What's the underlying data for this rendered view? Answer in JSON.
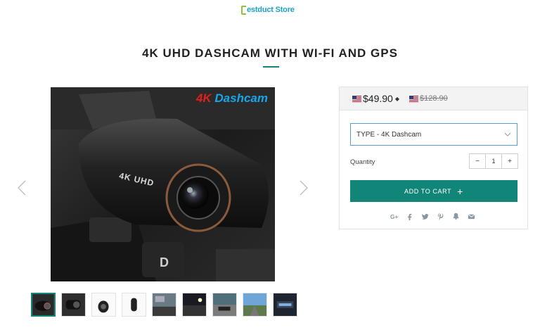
{
  "header": {
    "logo_initial": "B",
    "logo_text": "estduct Store"
  },
  "product": {
    "title": "4K UHD DASHCAM WITH WI-FI AND GPS",
    "image_badge_4k": "4K",
    "image_badge_dashcam": " Dashcam",
    "image_print_text": "4K UHD"
  },
  "pricing": {
    "price": "$49.90",
    "currency_caret": "◆",
    "compare_price": "$128.90",
    "flag": "us-flag-icon"
  },
  "variant": {
    "label": "TYPE",
    "value": "4K Dashcam",
    "display": "TYPE  -  4K Dashcam"
  },
  "quantity": {
    "label": "Quantity",
    "value": "1",
    "minus": "−",
    "plus": "+"
  },
  "cart": {
    "label": "ADD TO CART",
    "plus": "+"
  },
  "share_icons": [
    "google-plus-icon",
    "facebook-icon",
    "twitter-icon",
    "pinterest-icon",
    "fancy-icon",
    "email-icon"
  ],
  "share": {
    "gplus": "G+"
  },
  "thumbnails": [
    "thumb-1",
    "thumb-2",
    "thumb-3",
    "thumb-4",
    "thumb-5",
    "thumb-6",
    "thumb-7",
    "thumb-8",
    "thumb-9"
  ],
  "colors": {
    "accent": "#118577",
    "select_border": "#5a9ccf",
    "logo_blue": "#1aa3c4",
    "logo_green": "#8cc63f"
  }
}
